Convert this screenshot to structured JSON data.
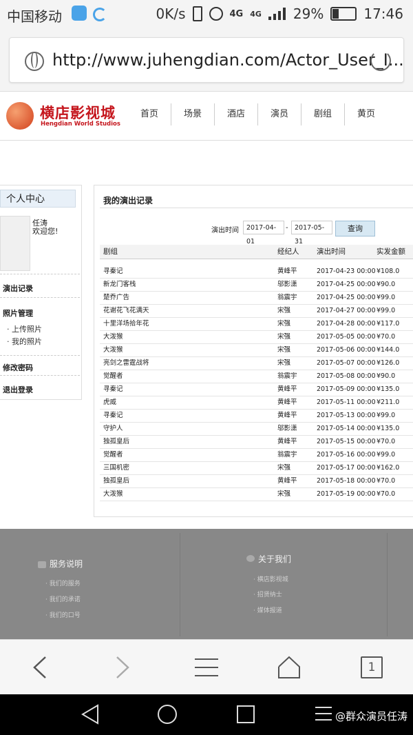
{
  "status_bar": {
    "carrier": "中国移动",
    "network_speed": "0K/s",
    "net_type_1": "4G",
    "net_type_2": "4G",
    "battery_percent": "29%",
    "battery_level": 0.29,
    "time": "17:46"
  },
  "browser": {
    "url": "http://www.juhengdian.com/Actor_User_I...",
    "tab_count": "1"
  },
  "site": {
    "logo_cn": "横店影视城",
    "logo_en": "Hengdian World Studios",
    "nav": [
      "首页",
      "场景",
      "酒店",
      "演员",
      "剧组",
      "黄页"
    ]
  },
  "sidebar": {
    "title": "个人中心",
    "user_name": "任涛",
    "welcome": "欢迎您!",
    "performance_records": "演出记录",
    "photo_management": "照片管理",
    "upload_photos": "上传照片",
    "my_photos": "我的照片",
    "change_password": "修改密码",
    "logout": "退出登录"
  },
  "main": {
    "title": "我的演出记录",
    "filter_label": "演出时间",
    "date_from": "2017-04-01",
    "date_separator": "-",
    "date_to": "2017-05-31",
    "query_button": "查询",
    "columns": [
      "剧组",
      "经纪人",
      "演出时间",
      "实发金额"
    ],
    "rows": [
      [
        "寻秦记",
        "黄峰平",
        "2017-04-23 00:00",
        "¥108.0"
      ],
      [
        "新龙门客栈",
        "邬影潇",
        "2017-04-25 00:00",
        "¥90.0"
      ],
      [
        "楚乔广告",
        "翁震宇",
        "2017-04-25 00:00",
        "¥99.0"
      ],
      [
        "花谢花飞花满天",
        "宋强",
        "2017-04-27 00:00",
        "¥99.0"
      ],
      [
        "十里洋场拾年花",
        "宋强",
        "2017-04-28 00:00",
        "¥117.0"
      ],
      [
        "大泼猴",
        "宋强",
        "2017-05-05 00:00",
        "¥70.0"
      ],
      [
        "大泼猴",
        "宋强",
        "2017-05-06 00:00",
        "¥144.0"
      ],
      [
        "亮剑之雷霆战将",
        "宋强",
        "2017-05-07 00:00",
        "¥126.0"
      ],
      [
        "觉醒者",
        "翁震宇",
        "2017-05-08 00:00",
        "¥90.0"
      ],
      [
        "寻秦记",
        "黄峰平",
        "2017-05-09 00:00",
        "¥135.0"
      ],
      [
        "虎威",
        "黄峰平",
        "2017-05-11 00:00",
        "¥211.0"
      ],
      [
        "寻秦记",
        "黄峰平",
        "2017-05-13 00:00",
        "¥99.0"
      ],
      [
        "守护人",
        "邬影潇",
        "2017-05-14 00:00",
        "¥135.0"
      ],
      [
        "独孤皇后",
        "黄峰平",
        "2017-05-15 00:00",
        "¥70.0"
      ],
      [
        "觉醒者",
        "翁震宇",
        "2017-05-16 00:00",
        "¥99.0"
      ],
      [
        "三国机密",
        "宋强",
        "2017-05-17 00:00",
        "¥162.0"
      ],
      [
        "独孤皇后",
        "黄峰平",
        "2017-05-18 00:00",
        "¥70.0"
      ],
      [
        "大泼猴",
        "宋强",
        "2017-05-19 00:00",
        "¥70.0"
      ]
    ]
  },
  "footer": {
    "service_title": "服务说明",
    "service_items": [
      "我们的服务",
      "我们的承诺",
      "我们的口号"
    ],
    "about_title": "关于我们",
    "about_items": [
      "横店影视城",
      "招贤纳士",
      "媒体报道"
    ]
  },
  "watermark": "@群众演员任涛"
}
